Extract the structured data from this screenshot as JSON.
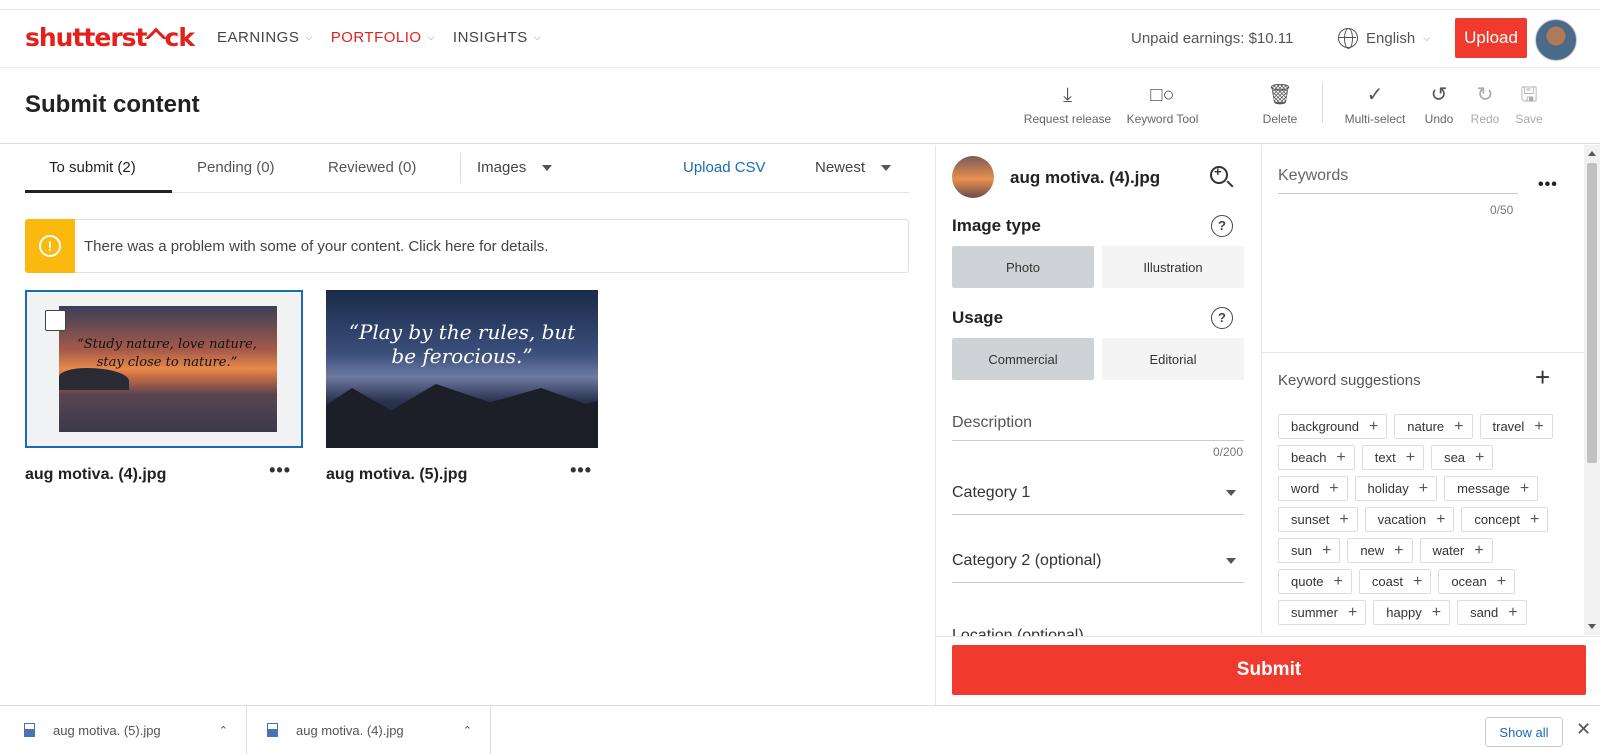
{
  "header": {
    "logo": "shutterstock",
    "nav": [
      {
        "label": "EARNINGS",
        "active": false
      },
      {
        "label": "PORTFOLIO",
        "active": true
      },
      {
        "label": "INSIGHTS",
        "active": false
      }
    ],
    "unpaid": "Unpaid earnings: $10.11",
    "language": "English",
    "upload_label": "Upload"
  },
  "titlebar": {
    "title": "Submit content",
    "tools": [
      {
        "label": "Request release",
        "icon": "download-tray-icon",
        "enabled": true
      },
      {
        "label": "Keyword Tool",
        "icon": "shapes-icon",
        "enabled": true
      },
      {
        "label": "Delete",
        "icon": "trash-icon",
        "enabled": true
      },
      {
        "label": "Multi-select",
        "icon": "checkmark-icon",
        "enabled": true
      },
      {
        "label": "Undo",
        "icon": "undo-icon",
        "enabled": true
      },
      {
        "label": "Redo",
        "icon": "redo-icon",
        "enabled": false
      },
      {
        "label": "Save",
        "icon": "save-icon",
        "enabled": false
      }
    ]
  },
  "tabs": {
    "items": [
      "To submit (2)",
      "Pending (0)",
      "Reviewed (0)"
    ],
    "filter": "Images",
    "upload_csv": "Upload CSV",
    "sort": "Newest"
  },
  "alert": {
    "text": "There was a problem with some of your content. Click here for details."
  },
  "files": [
    {
      "name": "aug motiva. (4).jpg",
      "quote": "“Study nature, love nature, stay close to nature.”"
    },
    {
      "name": "aug motiva. (5).jpg",
      "quote": "“Play by the rules, but be ferocious.”"
    }
  ],
  "details": {
    "filename": "aug motiva. (4).jpg",
    "image_type_label": "Image type",
    "image_type_options": [
      "Photo",
      "Illustration"
    ],
    "usage_label": "Usage",
    "usage_options": [
      "Commercial",
      "Editorial"
    ],
    "description_placeholder": "Description",
    "description_count": "0/200",
    "category1": "Category 1",
    "category2": "Category 2 (optional)",
    "location": "Location (optional)",
    "submit_label": "Submit"
  },
  "keywords": {
    "placeholder": "Keywords",
    "count": "0/50",
    "suggestions_label": "Keyword suggestions",
    "suggestions": [
      "background",
      "nature",
      "travel",
      "beach",
      "text",
      "sea",
      "word",
      "holiday",
      "message",
      "sunset",
      "vacation",
      "concept",
      "sun",
      "new",
      "water",
      "quote",
      "coast",
      "ocean",
      "summer",
      "happy",
      "sand"
    ]
  },
  "downloads": {
    "items": [
      "aug motiva. (5).jpg",
      "aug motiva. (4).jpg"
    ],
    "show_all": "Show all"
  },
  "colors": {
    "brand_red": "#e2211c",
    "submit_red": "#f03a2e",
    "alert_yellow": "#fbb80f",
    "link_blue": "#1a6ab8"
  }
}
